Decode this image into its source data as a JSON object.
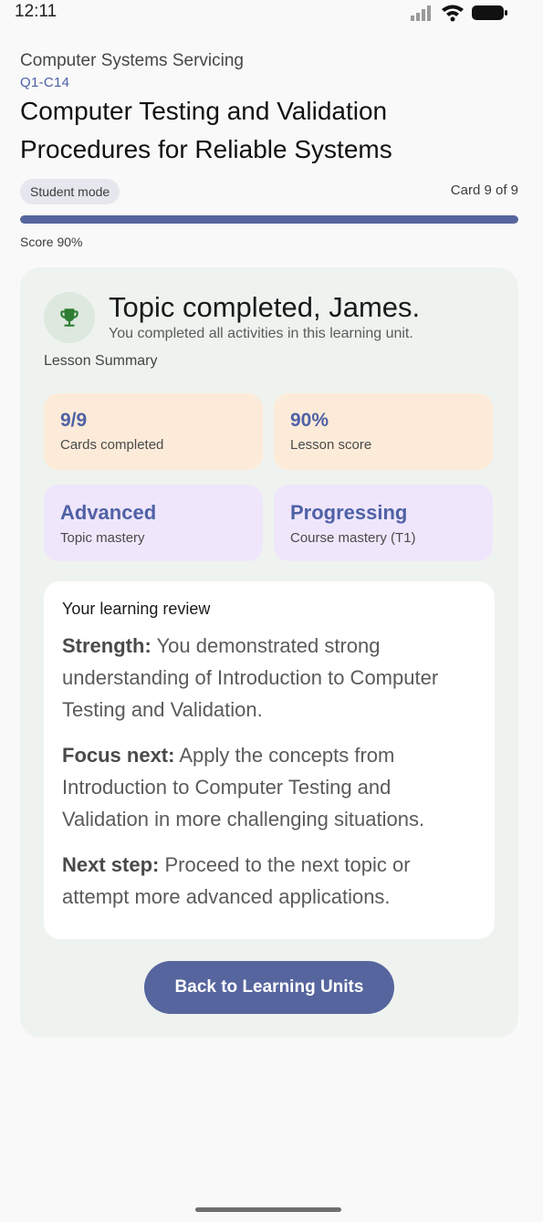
{
  "status_bar": {
    "time": "12:11",
    "icons": [
      "signal-icon",
      "wifi-icon",
      "battery-icon"
    ]
  },
  "header": {
    "subject": "Computer Systems Servicing",
    "code": "Q1-C14",
    "title_line1": "Computer Testing and Validation",
    "title_line2": "Procedures for Reliable Systems",
    "mode": "Student mode",
    "card_count": "Card 9 of 9",
    "progress_percent": 100,
    "score": "Score 90%"
  },
  "completion": {
    "icon": "trophy-icon",
    "title": "Topic completed, James.",
    "subtitle": "You completed all activities in this learning unit.",
    "summary_label": "Lesson Summary"
  },
  "stats": [
    {
      "value": "9/9",
      "label": "Cards completed"
    },
    {
      "value": "90%",
      "label": "Lesson score"
    },
    {
      "value": "Advanced",
      "label": "Topic mastery"
    },
    {
      "value": "Progressing",
      "label": "Course mastery (T1)"
    }
  ],
  "review": {
    "heading": "Your learning review",
    "items": [
      {
        "label": "Strength:",
        "text": " You demonstrated strong understanding of Introduction to Computer Testing and Validation."
      },
      {
        "label": "Focus next:",
        "text": " Apply the concepts from Introduction to Computer Testing and Validation in more challenging situations."
      },
      {
        "label": "Next step:",
        "text": " Proceed to the next topic or attempt more advanced applications."
      }
    ]
  },
  "actions": {
    "back_label": "Back to Learning Units"
  },
  "colors": {
    "accent": "#56659d",
    "panel": "#eff3ef",
    "stat_orange": "#fdebd9",
    "stat_purple": "#efe6fb",
    "trophy": "#2e7d32"
  }
}
